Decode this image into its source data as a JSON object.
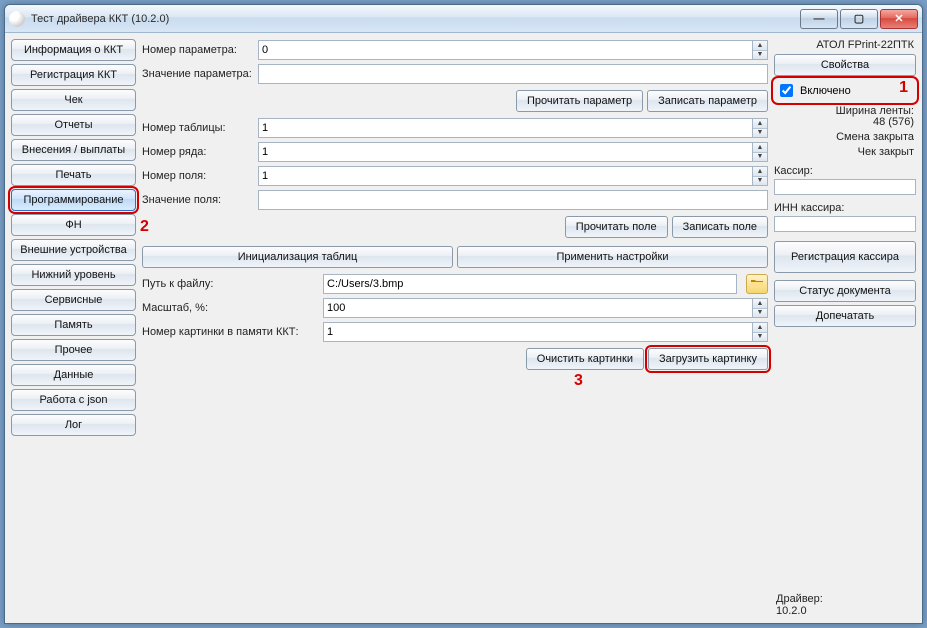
{
  "window": {
    "title": "Тест драйвера ККТ (10.2.0)"
  },
  "nav": {
    "info": "Информация о ККТ",
    "reg": "Регистрация ККТ",
    "cheque": "Чек",
    "reports": "Отчеты",
    "cash": "Внесения / выплаты",
    "print": "Печать",
    "programming": "Программирование",
    "fn": "ФН",
    "ext": "Внешние устройства",
    "low": "Нижний уровень",
    "service": "Сервисные",
    "memory": "Память",
    "other": "Прочее",
    "data": "Данные",
    "json": "Работа с json",
    "log": "Лог"
  },
  "center": {
    "param_no_label": "Номер параметра:",
    "param_no": "0",
    "param_val_label": "Значение параметра:",
    "param_val": "",
    "read_param": "Прочитать параметр",
    "write_param": "Записать параметр",
    "table_no_label": "Номер таблицы:",
    "table_no": "1",
    "row_no_label": "Номер ряда:",
    "row_no": "1",
    "field_no_label": "Номер поля:",
    "field_no": "1",
    "field_val_label": "Значение поля:",
    "field_val": "",
    "read_field": "Прочитать поле",
    "write_field": "Записать поле",
    "init_tables": "Инициализация таблиц",
    "apply_settings": "Применить настройки",
    "path_label": "Путь к файлу:",
    "path": "C:/Users/3.bmp",
    "scale_label": "Масштаб, %:",
    "scale": "100",
    "img_no_label": "Номер картинки в памяти ККТ:",
    "img_no": "1",
    "clear_images": "Очистить картинки",
    "load_image": "Загрузить картинку"
  },
  "right": {
    "device": "АТОЛ FPrint-22ПТК",
    "properties": "Свойства",
    "enabled": "Включено",
    "tape_label": "Ширина ленты:",
    "tape_value": "48 (576)",
    "shift": "Смена закрыта",
    "cheque": "Чек закрыт",
    "cashier_label": "Кассир:",
    "cashier_inn_label": "ИНН кассира:",
    "reg_cashier": "Регистрация кассира",
    "doc_status": "Статус документа",
    "reprint": "Допечатать",
    "driver_label": "Драйвер:",
    "driver_ver": "10.2.0"
  },
  "annot": {
    "one": "1",
    "two": "2",
    "three": "3"
  }
}
